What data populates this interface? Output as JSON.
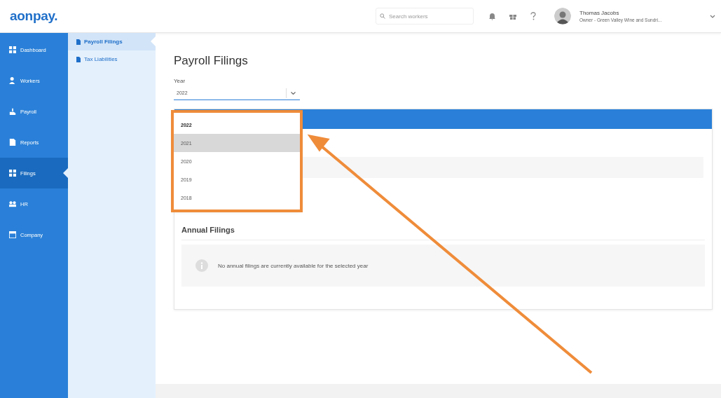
{
  "header": {
    "logo": "aonpay.",
    "search": {
      "placeholder": "Search workers"
    },
    "user": {
      "name": "Thomas Jacobs",
      "role": "Owner - Green Valley Wine and Sundri..."
    }
  },
  "nav": [
    {
      "label": "Dashboard",
      "selected": false
    },
    {
      "label": "Workers",
      "selected": false
    },
    {
      "label": "Payroll",
      "selected": false
    },
    {
      "label": "Reports",
      "selected": false
    },
    {
      "label": "Filings",
      "selected": true
    },
    {
      "label": "HR",
      "selected": false
    },
    {
      "label": "Company",
      "selected": false
    }
  ],
  "subnav": [
    {
      "label": "Payroll Filings",
      "selected": true
    },
    {
      "label": "Tax Liabilities",
      "selected": false
    }
  ],
  "page": {
    "title": "Payroll Filings",
    "year_field": {
      "label": "Year",
      "value": "2022",
      "expanded": true,
      "options": [
        {
          "label": "2022",
          "selected": true,
          "highlighted": false
        },
        {
          "label": "2021",
          "selected": false,
          "highlighted": true
        },
        {
          "label": "2020",
          "selected": false,
          "highlighted": false
        },
        {
          "label": "2019",
          "selected": false,
          "highlighted": false
        },
        {
          "label": "2018",
          "selected": false,
          "highlighted": false
        }
      ]
    },
    "annual_filings": {
      "title": "Annual Filings",
      "message": "No annual filings are currently available for the selected year"
    }
  }
}
